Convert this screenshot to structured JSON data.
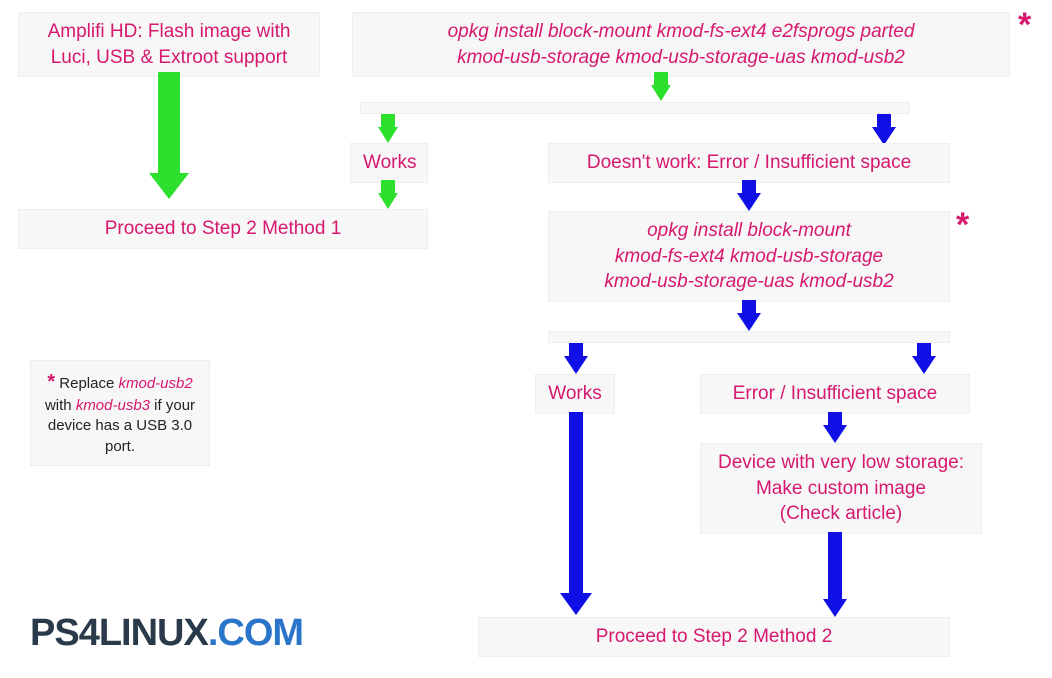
{
  "boxes": {
    "amplifi": "Amplifi HD: Flash image with\nLuci, USB & Extroot support",
    "opkg_full": "opkg install block-mount kmod-fs-ext4 e2fsprogs parted\nkmod-usb-storage kmod-usb-storage-uas kmod-usb2",
    "works1": "Works",
    "doesnt_work": "Doesn't work: Error / Insufficient space",
    "proceed_m1": "Proceed to Step 2 Method 1",
    "opkg_short": "opkg install block-mount\nkmod-fs-ext4 kmod-usb-storage\nkmod-usb-storage-uas kmod-usb2",
    "works2": "Works",
    "error2": "Error / Insufficient space",
    "low_storage": "Device with very low storage:\nMake custom image\n(Check article)",
    "proceed_m2": "Proceed to Step 2 Method 2"
  },
  "note": {
    "star": "*",
    "prefix": " Replace ",
    "em1": "kmod-usb2",
    "middle": " with ",
    "em2": "kmod-usb3",
    "suffix": " if your device has a USB 3.0 port."
  },
  "logo": {
    "p1": "PS4LINUX",
    "dot": ".",
    "com": "COM"
  },
  "asterisks": {
    "a1": "*",
    "a2": "*"
  }
}
